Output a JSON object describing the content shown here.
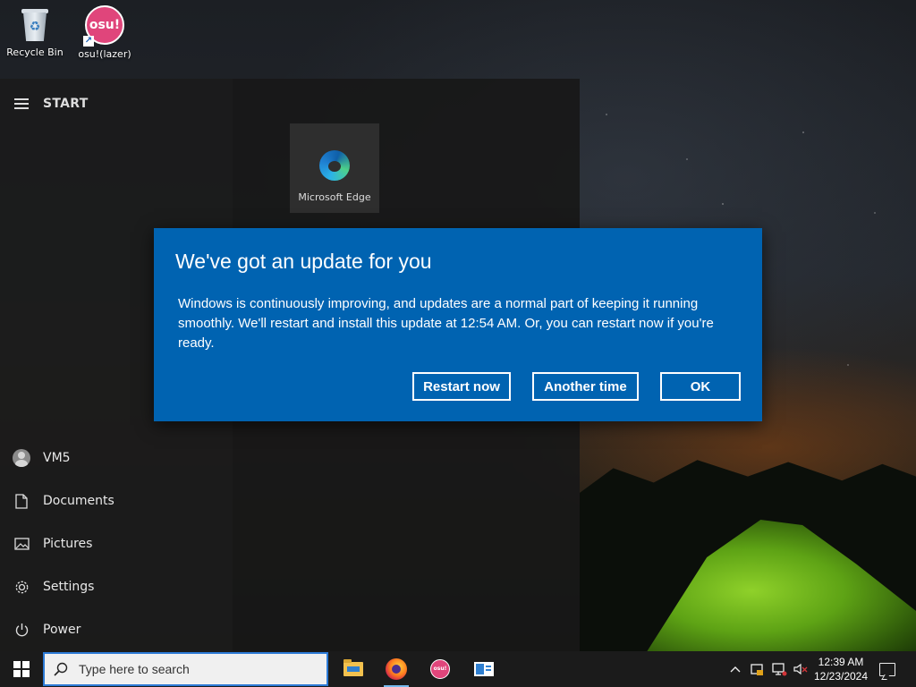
{
  "desktop": {
    "icons": [
      {
        "label": "Recycle Bin"
      },
      {
        "label": "osu!(lazer)"
      }
    ]
  },
  "start_menu": {
    "title": "START",
    "tile": {
      "label": "Microsoft Edge"
    },
    "items": [
      {
        "label": "VM5",
        "icon": "user-avatar-icon"
      },
      {
        "label": "Documents",
        "icon": "document-icon"
      },
      {
        "label": "Pictures",
        "icon": "pictures-icon"
      },
      {
        "label": "Settings",
        "icon": "gear-icon"
      },
      {
        "label": "Power",
        "icon": "power-icon"
      }
    ]
  },
  "dialog": {
    "title": "We've got an update for you",
    "body": "Windows is continuously improving, and updates are a normal part of keeping it running smoothly. We'll restart and install this update at 12:54 AM. Or, you can restart now if you're ready.",
    "buttons": {
      "restart_now": "Restart now",
      "another_time": "Another time",
      "ok": "OK"
    },
    "accent": "#0063b1"
  },
  "taskbar": {
    "search_placeholder": "Type here to search",
    "osu_icon_text": "osu!",
    "clock": {
      "time": "12:39 AM",
      "date": "12/23/2024"
    }
  }
}
